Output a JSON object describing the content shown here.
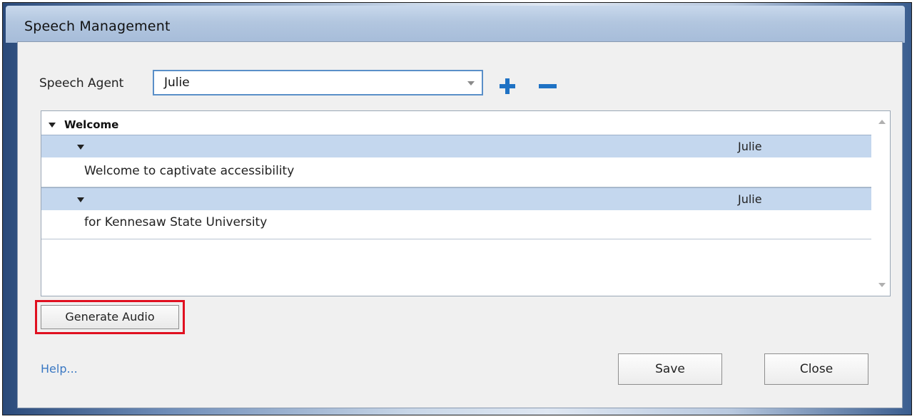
{
  "window": {
    "title": "Speech Management"
  },
  "speech_agent": {
    "label": "Speech Agent",
    "value": "Julie"
  },
  "list": {
    "group": "Welcome",
    "items": [
      {
        "agent": "Julie",
        "text": "Welcome to captivate accessibility"
      },
      {
        "agent": "Julie",
        "text": "for Kennesaw State University"
      }
    ]
  },
  "buttons": {
    "generate_audio": "Generate Audio",
    "help": "Help...",
    "save": "Save",
    "close": "Close"
  },
  "colors": {
    "accent": "#1f72c4",
    "highlight_outline": "#e01020",
    "row_selected": "#c4d7ee",
    "link": "#3a78c3"
  }
}
